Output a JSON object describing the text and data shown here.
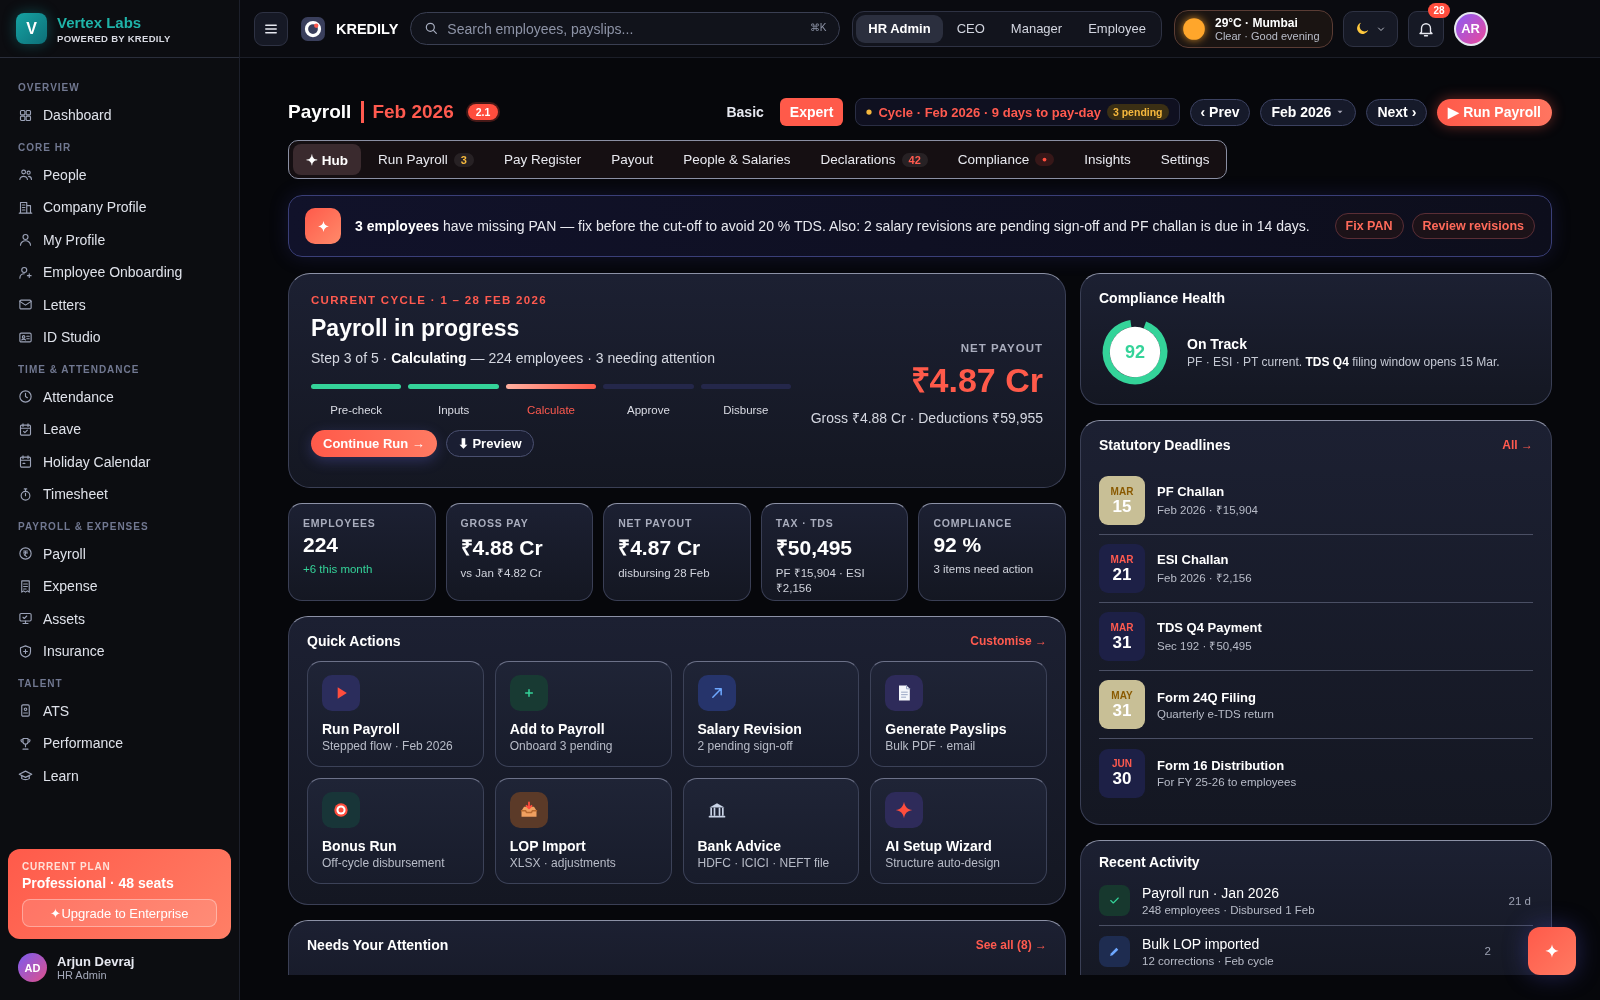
{
  "sidebar": {
    "brand": {
      "initial": "V",
      "name": "Vertex Labs",
      "tagline": "POWERED BY KREDILY"
    },
    "sections": [
      {
        "title": "OVERVIEW",
        "items": [
          "Dashboard"
        ]
      },
      {
        "title": "CORE HR",
        "items": [
          "People",
          "Company Profile",
          "My Profile",
          "Employee Onboarding",
          "Letters",
          "ID Studio"
        ]
      },
      {
        "title": "TIME & ATTENDANCE",
        "items": [
          "Attendance",
          "Leave",
          "Holiday Calendar",
          "Timesheet"
        ]
      },
      {
        "title": "PAYROLL & EXPENSES",
        "items": [
          "Payroll",
          "Expense",
          "Assets",
          "Insurance"
        ]
      },
      {
        "title": "TALENT",
        "items": [
          "ATS",
          "Performance",
          "Learn"
        ]
      }
    ],
    "plan": {
      "label": "CURRENT PLAN",
      "name": "Professional · 48 seats",
      "button": "✦Upgrade to Enterprise"
    },
    "user": {
      "initials": "AD",
      "name": "Arjun Devraj",
      "role": "HR Admin"
    }
  },
  "topbar": {
    "brand": "KREDILY",
    "search": {
      "placeholder": "Search employees, payslips...",
      "shortcut": "⌘K"
    },
    "roles": [
      {
        "label": "HR Admin",
        "selected": true
      },
      {
        "label": "CEO",
        "selected": false
      },
      {
        "label": "Manager",
        "selected": false
      },
      {
        "label": "Employee",
        "selected": false
      }
    ],
    "weather": {
      "temp": "29°C · Mumbai",
      "desc": "Clear · Good evening"
    },
    "dark_mode": true,
    "notifications": "28",
    "avatar": "AR"
  },
  "header": {
    "title": "Payroll",
    "period": "Feb 2026",
    "version": "2.1",
    "modes": [
      {
        "label": "Basic",
        "selected": false
      },
      {
        "label": "Expert",
        "selected": true
      }
    ],
    "cycle": {
      "text": "Cycle · Feb 2026 · 9 days to pay-day",
      "pending": "3 pending"
    },
    "prev": "‹ Prev",
    "month": "Feb 2026",
    "next": "Next ›",
    "run": "▶ Run Payroll"
  },
  "tabs": [
    {
      "label": "✦ Hub",
      "selected": true,
      "alert": false
    },
    {
      "label": "Run Payroll",
      "count": "3",
      "color": "#f5b83d",
      "selected": false,
      "alert": false
    },
    {
      "label": "Pay Register",
      "selected": false,
      "alert": false
    },
    {
      "label": "Payout",
      "selected": false,
      "alert": false
    },
    {
      "label": "People & Salaries",
      "selected": false,
      "alert": false
    },
    {
      "label": "Declarations",
      "count": "42",
      "color": "#ff5a4f",
      "selected": false,
      "alert": false
    },
    {
      "label": "Compliance",
      "selected": false,
      "alert": true
    },
    {
      "label": "Insights",
      "selected": false,
      "alert": false
    },
    {
      "label": "Settings",
      "selected": false,
      "alert": false
    }
  ],
  "banner": {
    "message": "**3 employees** have missing PAN — fix before the cut-off to avoid 20 % TDS. Also: 2 salary revisions are pending sign-off and PF challan is due in 14 days.",
    "actions": [
      "Fix PAN",
      "Review revisions"
    ]
  },
  "hero": {
    "eyebrow": "CURRENT CYCLE · 1 – 28 FEB 2026",
    "title": "Payroll in progress",
    "summary": "Step 3 of 5 · **Calculating** — 224 employees · 3 needing attention",
    "steps": [
      {
        "label": "Pre-check",
        "kind": "done"
      },
      {
        "label": "Inputs",
        "kind": "done"
      },
      {
        "label": "Calculate",
        "kind": "current"
      },
      {
        "label": "Approve",
        "kind": "todo"
      },
      {
        "label": "Disburse",
        "kind": "todo"
      }
    ],
    "net_label": "NET PAYOUT",
    "net_value": "₹4.87 Cr",
    "breakdown": "Gross ₹4.88 Cr · Deductions ₹59,955",
    "primary": "Continue Run →",
    "secondary": "⬇ Preview"
  },
  "stats": [
    {
      "label": "EMPLOYEES",
      "value": "224",
      "note": "+6 this month",
      "kind": "positive"
    },
    {
      "label": "GROSS PAY",
      "value": "₹4.88 Cr",
      "note": "vs Jan ₹4.82 Cr",
      "kind": "neutral"
    },
    {
      "label": "NET PAYOUT",
      "value": "₹4.87 Cr",
      "note": "disbursing 28 Feb",
      "kind": "neutral"
    },
    {
      "label": "TAX · TDS",
      "value": "₹50,495",
      "note": "PF ₹15,904 · ESI ₹2,156",
      "kind": "neutral"
    },
    {
      "label": "COMPLIANCE",
      "value": "92 %",
      "note": "3 items need action",
      "kind": "neutral"
    }
  ],
  "quick_actions": {
    "title": "Quick Actions",
    "link": "Customise →",
    "items": [
      {
        "title": "Run Payroll",
        "subtitle": "Stepped flow · Feb 2026"
      },
      {
        "title": "Add to Payroll",
        "subtitle": "Onboard 3 pending"
      },
      {
        "title": "Salary Revision",
        "subtitle": "2 pending sign-off"
      },
      {
        "title": "Generate Payslips",
        "subtitle": "Bulk PDF · email"
      },
      {
        "title": "Bonus Run",
        "subtitle": "Off-cycle disbursement"
      },
      {
        "title": "LOP Import",
        "subtitle": "XLSX · adjustments"
      },
      {
        "title": "Bank Advice",
        "subtitle": "HDFC · ICICI · NEFT file"
      },
      {
        "title": "AI Setup Wizard",
        "subtitle": "Structure auto-design"
      }
    ]
  },
  "attention": {
    "title": "Needs Your Attention",
    "link": "See all (8) →"
  },
  "compliance": {
    "title": "Compliance Health",
    "score": "92",
    "status": "On Track",
    "detail": "PF · ESI · PT current. **TDS Q4** filing window opens 15 Mar."
  },
  "deadlines": {
    "title": "Statutory Deadlines",
    "link": "All →",
    "items": [
      {
        "month": "MAR",
        "day": "15",
        "title": "PF Challan",
        "subtitle": "Feb 2026 · ₹15,904",
        "highlighted": true
      },
      {
        "month": "MAR",
        "day": "21",
        "title": "ESI Challan",
        "subtitle": "Feb 2026 · ₹2,156",
        "highlighted": false
      },
      {
        "month": "MAR",
        "day": "31",
        "title": "TDS Q4 Payment",
        "subtitle": "Sec 192 · ₹50,495",
        "highlighted": false
      },
      {
        "month": "MAY",
        "day": "31",
        "title": "Form 24Q Filing",
        "subtitle": "Quarterly e-TDS return",
        "highlighted": true
      },
      {
        "month": "JUN",
        "day": "30",
        "title": "Form 16 Distribution",
        "subtitle": "For FY 25-26 to employees",
        "highlighted": false
      }
    ]
  },
  "activity": {
    "title": "Recent Activity",
    "items": [
      {
        "title": "Payroll run · Jan 2026",
        "subtitle": "248 employees · Disbursed 1 Feb",
        "time": "21 d",
        "kind": "done"
      },
      {
        "title": "Bulk LOP imported",
        "subtitle": "12 corrections · Feb cycle",
        "time": "2",
        "kind": "edit"
      }
    ]
  }
}
